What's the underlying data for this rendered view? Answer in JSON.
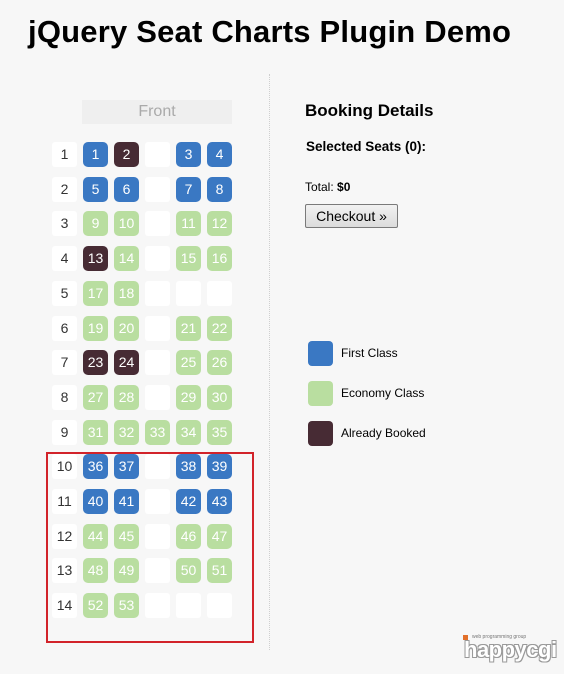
{
  "page": {
    "title": "jQuery Seat Charts Plugin Demo"
  },
  "seat_map": {
    "front_label": "Front",
    "rows": [
      {
        "label": "1",
        "seats": [
          [
            "1",
            "first"
          ],
          [
            "2",
            "booked"
          ],
          [
            "",
            ""
          ],
          [
            "3",
            "first"
          ],
          [
            "4",
            "first"
          ]
        ]
      },
      {
        "label": "2",
        "seats": [
          [
            "5",
            "first"
          ],
          [
            "6",
            "first"
          ],
          [
            "",
            ""
          ],
          [
            "7",
            "first"
          ],
          [
            "8",
            "first"
          ]
        ]
      },
      {
        "label": "3",
        "seats": [
          [
            "9",
            "economy"
          ],
          [
            "10",
            "economy"
          ],
          [
            "",
            ""
          ],
          [
            "11",
            "economy"
          ],
          [
            "12",
            "economy"
          ]
        ]
      },
      {
        "label": "4",
        "seats": [
          [
            "13",
            "booked"
          ],
          [
            "14",
            "economy"
          ],
          [
            "",
            ""
          ],
          [
            "15",
            "economy"
          ],
          [
            "16",
            "economy"
          ]
        ]
      },
      {
        "label": "5",
        "seats": [
          [
            "17",
            "economy"
          ],
          [
            "18",
            "economy"
          ],
          [
            "",
            ""
          ],
          [
            "",
            ""
          ],
          [
            "",
            ""
          ]
        ]
      },
      {
        "label": "6",
        "seats": [
          [
            "19",
            "economy"
          ],
          [
            "20",
            "economy"
          ],
          [
            "",
            ""
          ],
          [
            "21",
            "economy"
          ],
          [
            "22",
            "economy"
          ]
        ]
      },
      {
        "label": "7",
        "seats": [
          [
            "23",
            "booked"
          ],
          [
            "24",
            "booked"
          ],
          [
            "",
            ""
          ],
          [
            "25",
            "economy"
          ],
          [
            "26",
            "economy"
          ]
        ]
      },
      {
        "label": "8",
        "seats": [
          [
            "27",
            "economy"
          ],
          [
            "28",
            "economy"
          ],
          [
            "",
            ""
          ],
          [
            "29",
            "economy"
          ],
          [
            "30",
            "economy"
          ]
        ]
      },
      {
        "label": "9",
        "seats": [
          [
            "31",
            "economy"
          ],
          [
            "32",
            "economy"
          ],
          [
            "33",
            "economy"
          ],
          [
            "34",
            "economy"
          ],
          [
            "35",
            "economy"
          ]
        ]
      },
      {
        "label": "10",
        "seats": [
          [
            "36",
            "first"
          ],
          [
            "37",
            "first"
          ],
          [
            "",
            ""
          ],
          [
            "38",
            "first"
          ],
          [
            "39",
            "first"
          ]
        ]
      },
      {
        "label": "11",
        "seats": [
          [
            "40",
            "first"
          ],
          [
            "41",
            "first"
          ],
          [
            "",
            ""
          ],
          [
            "42",
            "first"
          ],
          [
            "43",
            "first"
          ]
        ]
      },
      {
        "label": "12",
        "seats": [
          [
            "44",
            "economy"
          ],
          [
            "45",
            "economy"
          ],
          [
            "",
            ""
          ],
          [
            "46",
            "economy"
          ],
          [
            "47",
            "economy"
          ]
        ]
      },
      {
        "label": "13",
        "seats": [
          [
            "48",
            "economy"
          ],
          [
            "49",
            "economy"
          ],
          [
            "",
            ""
          ],
          [
            "50",
            "economy"
          ],
          [
            "51",
            "economy"
          ]
        ]
      },
      {
        "label": "14",
        "seats": [
          [
            "52",
            "economy"
          ],
          [
            "53",
            "economy"
          ],
          [
            "",
            ""
          ],
          [
            "",
            ""
          ],
          [
            "",
            ""
          ]
        ]
      }
    ]
  },
  "booking": {
    "title": "Booking Details",
    "selected_seats": "Selected Seats (0):",
    "total_label": "Total: ",
    "total_value": "$0",
    "checkout_label": "Checkout »"
  },
  "legend": [
    {
      "label": "First Class",
      "color": "#3a78c3"
    },
    {
      "label": "Economy Class",
      "color": "#b9dea0"
    },
    {
      "label": "Already Booked",
      "color": "#472b34"
    }
  ],
  "logo": {
    "tagline": "web programming group",
    "wordmark": "happycgi"
  },
  "colors": {
    "first": "#3a78c3",
    "economy": "#b9dea0",
    "booked": "#472b34",
    "highlight": "#d2232a"
  }
}
